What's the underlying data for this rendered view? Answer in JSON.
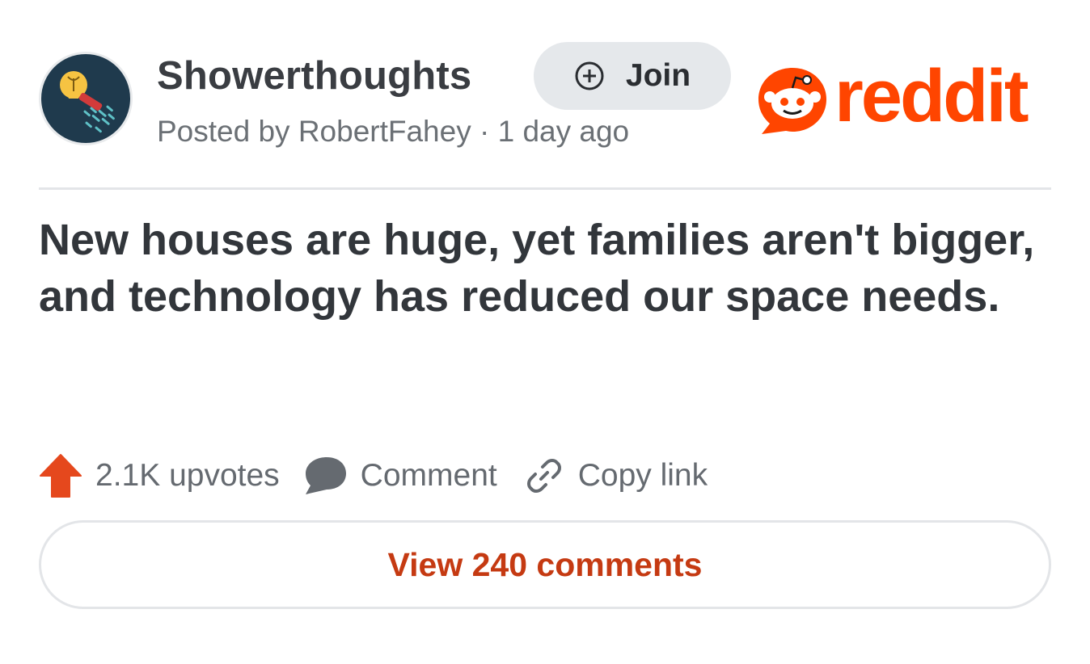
{
  "header": {
    "subreddit_name": "Showerthoughts",
    "posted_line": "Posted by RobertFahey · 1 day ago",
    "join_label": "Join",
    "brand_wordmark": "reddit"
  },
  "post": {
    "title": "New houses are huge, yet families aren't bigger, and technology has reduced our space needs."
  },
  "actions": {
    "upvotes_label": "2.1K upvotes",
    "comment_label": "Comment",
    "copy_link_label": "Copy link"
  },
  "footer": {
    "view_comments_label": "View 240 comments"
  },
  "icons": {
    "avatar": "lightbulb-shower-icon",
    "join": "plus-circle-icon",
    "brand": "reddit-snoo-icon",
    "upvote": "upvote-arrow-icon",
    "comment": "comment-bubble-icon",
    "copy_link": "chain-link-icon"
  },
  "colors": {
    "brand_orange": "#ff4500",
    "upvote_orange": "#e5481d",
    "view_comments_text": "#c53a12",
    "join_bg": "#e5e8eb",
    "avatar_bg": "#1f3a4d"
  }
}
